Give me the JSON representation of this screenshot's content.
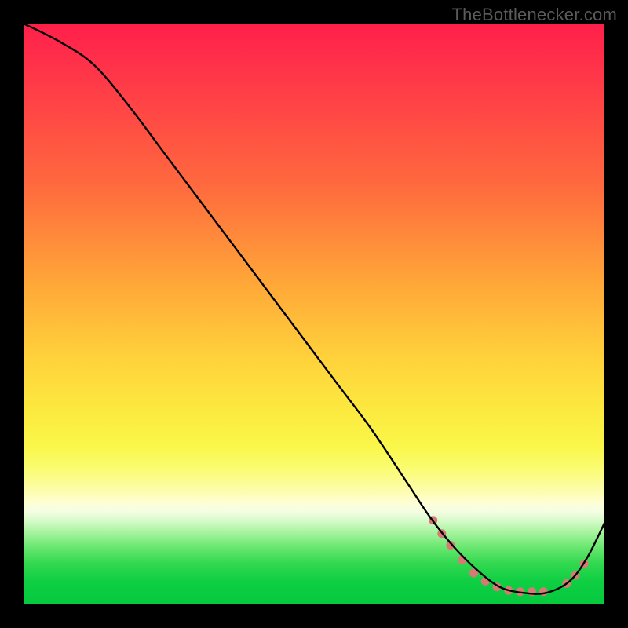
{
  "watermark": "TheBottlenecker.com",
  "chart_data": {
    "type": "line",
    "title": "",
    "xlabel": "",
    "ylabel": "",
    "xlim": [
      0,
      100
    ],
    "ylim": [
      0,
      100
    ],
    "x": [
      0,
      6,
      12,
      18,
      24,
      30,
      36,
      42,
      48,
      54,
      60,
      66,
      70,
      74,
      78,
      82,
      86,
      90,
      94,
      97,
      100
    ],
    "values": [
      100,
      97,
      93,
      86,
      78,
      70,
      62,
      54,
      46,
      38,
      30,
      21,
      15,
      10,
      6,
      3,
      2,
      2,
      4,
      8,
      14
    ],
    "markers": {
      "x": [
        70.5,
        72,
        73.5,
        75.5,
        77.5,
        79.5,
        81.5,
        83.5,
        85.5,
        87.5,
        89.5,
        93.5,
        95,
        96.5
      ],
      "y": [
        14.5,
        12.2,
        10.2,
        7.7,
        5.4,
        4.0,
        3.0,
        2.4,
        2.2,
        2.2,
        2.2,
        3.6,
        5.0,
        7.0
      ],
      "color": "#d77a76",
      "radius": 5.5
    },
    "curve_color": "#000000",
    "curve_width": 2.4
  }
}
